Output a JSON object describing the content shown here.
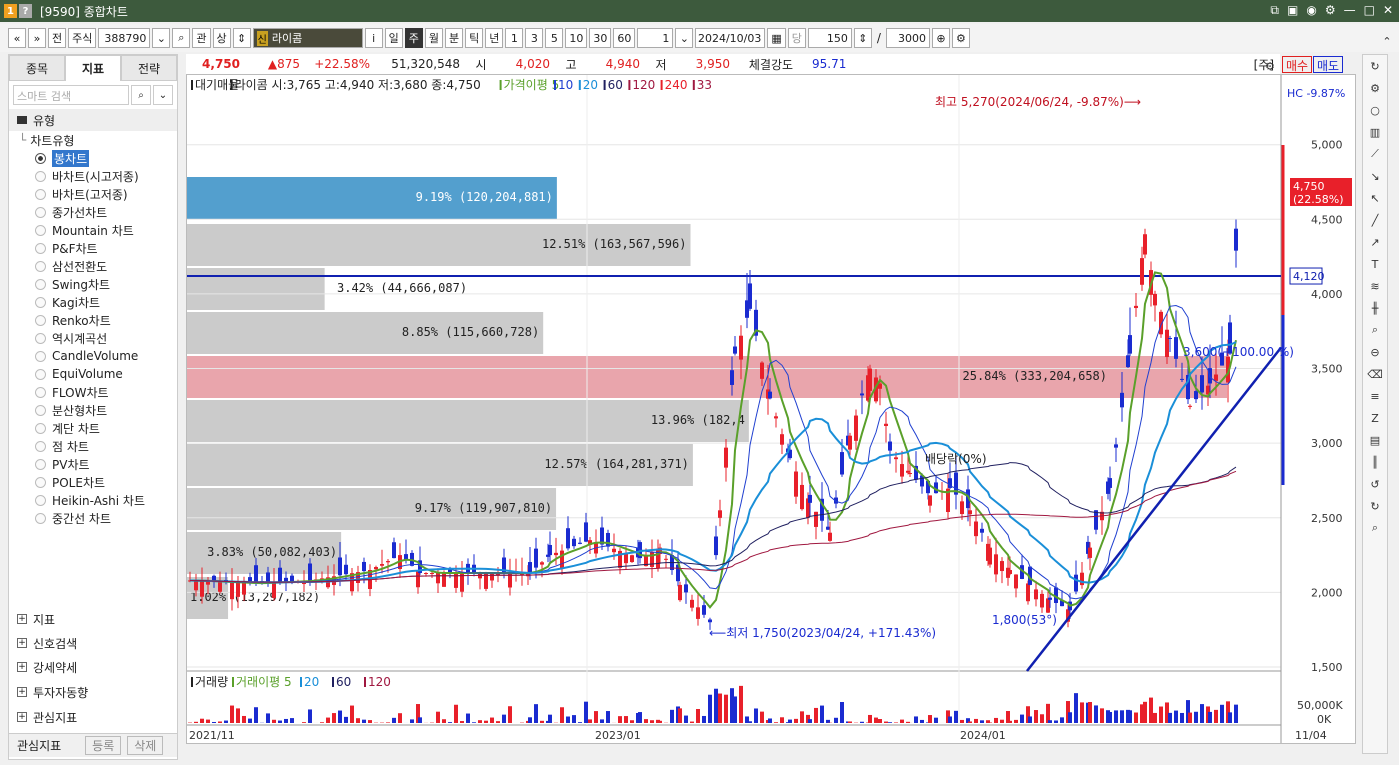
{
  "window": {
    "num1": "1",
    "num2": "?",
    "title": "[9590] 종합차트"
  },
  "toolbar": {
    "nav1": "«",
    "nav2": "»",
    "jeon": "전",
    "market": "주식",
    "code": "388790",
    "gwan": "관",
    "sang": "상",
    "stock_name": "라이콤",
    "info": "i",
    "periods": [
      "일",
      "주",
      "월",
      "분",
      "틱",
      "년"
    ],
    "nums": [
      "1",
      "3",
      "5",
      "10",
      "30",
      "60"
    ],
    "count1": "1",
    "date": "2024/10/03",
    "dang": "당",
    "count2": "150",
    "slash": "/",
    "count3": "3000"
  },
  "left": {
    "tabs": [
      "종목",
      "지표",
      "전략"
    ],
    "search_placeholder": "스마트 검색",
    "section": "유형",
    "tree_label": "차트유형",
    "types": [
      "봉차트",
      "바차트(시고저종)",
      "바차트(고저종)",
      "종가선차트",
      "Mountain 차트",
      "P&F차트",
      "삼선전환도",
      "Swing차트",
      "Kagi차트",
      "Renko차트",
      "역시계곡선",
      "CandleVolume",
      "EquiVolume",
      "FLOW차트",
      "분산형차트",
      "계단 차트",
      "점 차트",
      "PV차트",
      "POLE차트",
      "Heikin-Ashi 차트",
      "중간선 차트"
    ],
    "bottom": [
      "지표",
      "신호검색",
      "강세약세",
      "투자자동향",
      "관심지표"
    ],
    "footer": {
      "label": "관심지표",
      "reg": "등록",
      "del": "삭제"
    }
  },
  "infobar": {
    "price": "4,750",
    "change": "▲875",
    "pct": "+22.58%",
    "volume": "51,320,548",
    "o_label": "시",
    "o": "4,020",
    "h_label": "고",
    "h": "4,940",
    "l_label": "저",
    "l": "3,950",
    "strength_label": "체결강도",
    "strength": "95.71",
    "ju": "[주]",
    "buy": "매수",
    "sell": "매도"
  },
  "legend": {
    "items": [
      "대기매물",
      "라이콤 시:3,765 고:4,940 저:3,680 종:4,750",
      "가격이평 5",
      "10",
      "20",
      "60",
      "120",
      "240",
      "33"
    ],
    "hc": "HC  -9.87%"
  },
  "annotations": {
    "high": "최고 5,270(2024/06/24, -9.87%)⟶",
    "low": "⟵최저 1,750(2023/04/24, +171.43%)",
    "dividend": "배당락(0%)",
    "trend1": "1,800(53°)",
    "trend2": "3,600(+100.00 %)",
    "hline": "4,120",
    "price_tag1": "4,750",
    "price_tag2": "(22.58%)"
  },
  "volume_profile": [
    {
      "label": "9.19% (120,204,881)",
      "pct": 9.19
    },
    {
      "label": "12.51% (163,567,596)",
      "pct": 12.51
    },
    {
      "label": "3.42% (44,666,087)",
      "pct": 3.42
    },
    {
      "label": "8.85% (115,660,728)",
      "pct": 8.85
    },
    {
      "label": "25.84% (333,204,658)",
      "pct": 25.84
    },
    {
      "label": "13.96% (182,4",
      "pct": 13.96
    },
    {
      "label": "12.57% (164,281,371)",
      "pct": 12.57
    },
    {
      "label": "9.17% (119,907,810)",
      "pct": 9.17
    },
    {
      "label": "3.83% (50,082,403)",
      "pct": 3.83
    },
    {
      "label": "1.02% (13,297,182)",
      "pct": 1.02
    }
  ],
  "yaxis": [
    "5,000",
    "4,500",
    "4,000",
    "3,500",
    "3,000",
    "2,500",
    "2,000",
    "1,500"
  ],
  "xaxis": [
    "2021/11",
    "2023/01",
    "2024/01",
    "11/04"
  ],
  "vol_legend": [
    "거래량",
    "거래이평 5",
    "20",
    "60",
    "120"
  ],
  "vol_axis": [
    "50,000K",
    "0K"
  ],
  "colors": {
    "up": "#e8202a",
    "down": "#1a2bd0",
    "ma5": "#5aa02a",
    "ma20": "#1a8fd8",
    "hline": "#1020b0",
    "profile": "#c8c8c8",
    "profile_hi": "#4a9acb",
    "profile_pink": "#e8a0a8"
  }
}
